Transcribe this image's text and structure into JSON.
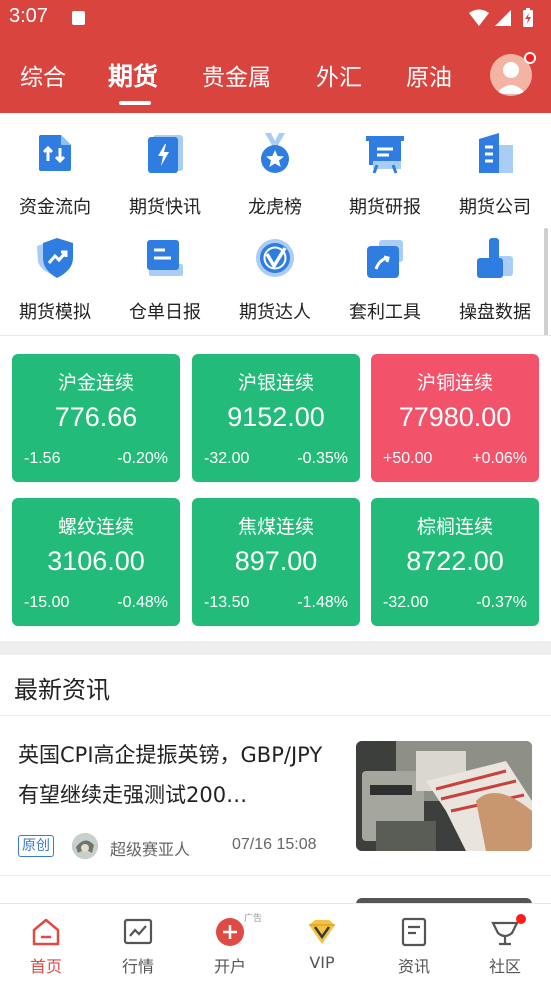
{
  "status_bar": {
    "time": "3:07"
  },
  "tabs": [
    {
      "label": "综合",
      "active": false
    },
    {
      "label": "期货",
      "active": true
    },
    {
      "label": "贵金属",
      "active": false
    },
    {
      "label": "外汇",
      "active": false
    },
    {
      "label": "原油",
      "active": false
    }
  ],
  "grid": [
    {
      "label": "资金流向",
      "icon": "fund-flow-icon"
    },
    {
      "label": "期货快讯",
      "icon": "flash-news-icon"
    },
    {
      "label": "龙虎榜",
      "icon": "medal-icon"
    },
    {
      "label": "期货研报",
      "icon": "research-report-icon"
    },
    {
      "label": "期货公司",
      "icon": "building-icon"
    },
    {
      "label": "期货模拟",
      "icon": "shield-trend-icon"
    },
    {
      "label": "仓单日报",
      "icon": "warehouse-report-icon"
    },
    {
      "label": "期货达人",
      "icon": "expert-check-icon"
    },
    {
      "label": "套利工具",
      "icon": "arbitrage-tool-icon"
    },
    {
      "label": "操盘数据",
      "icon": "trading-data-icon"
    }
  ],
  "quotes": [
    {
      "name": "沪金连续",
      "price": "776.66",
      "change": "-1.56",
      "pct": "-0.20%",
      "color": "#22bb79"
    },
    {
      "name": "沪银连续",
      "price": "9152.00",
      "change": "-32.00",
      "pct": "-0.35%",
      "color": "#22bb79"
    },
    {
      "name": "沪铜连续",
      "price": "77980.00",
      "change": "+50.00",
      "pct": "+0.06%",
      "color": "#f2536a"
    },
    {
      "name": "螺纹连续",
      "price": "3106.00",
      "change": "-15.00",
      "pct": "-0.48%",
      "color": "#22bb79"
    },
    {
      "name": "焦煤连续",
      "price": "897.00",
      "change": "-13.50",
      "pct": "-1.48%",
      "color": "#22bb79"
    },
    {
      "name": "棕榈连续",
      "price": "8722.00",
      "change": "-32.00",
      "pct": "-0.37%",
      "color": "#22bb79"
    }
  ],
  "news": {
    "section_title": "最新资讯",
    "items": [
      {
        "title": "英国CPI高企提振英镑，GBP/JPY有望继续走强测试200…",
        "tag": "原创",
        "author": "超级赛亚人",
        "date": "07/16 15:08"
      }
    ]
  },
  "bottom_nav": [
    {
      "label": "首页",
      "icon": "home-icon",
      "active": true
    },
    {
      "label": "行情",
      "icon": "chart-icon",
      "active": false
    },
    {
      "label": "开户",
      "icon": "open-account-icon",
      "active": false,
      "ad": "广告"
    },
    {
      "label": "VIP",
      "icon": "vip-diamond-icon",
      "active": false
    },
    {
      "label": "资讯",
      "icon": "news-doc-icon",
      "active": false
    },
    {
      "label": "社区",
      "icon": "community-trophy-icon",
      "active": false
    }
  ],
  "colors": {
    "brand": "#d9443f",
    "up": "#f2536a",
    "down": "#22bb79",
    "icon_blue": "#3a7bd5"
  }
}
